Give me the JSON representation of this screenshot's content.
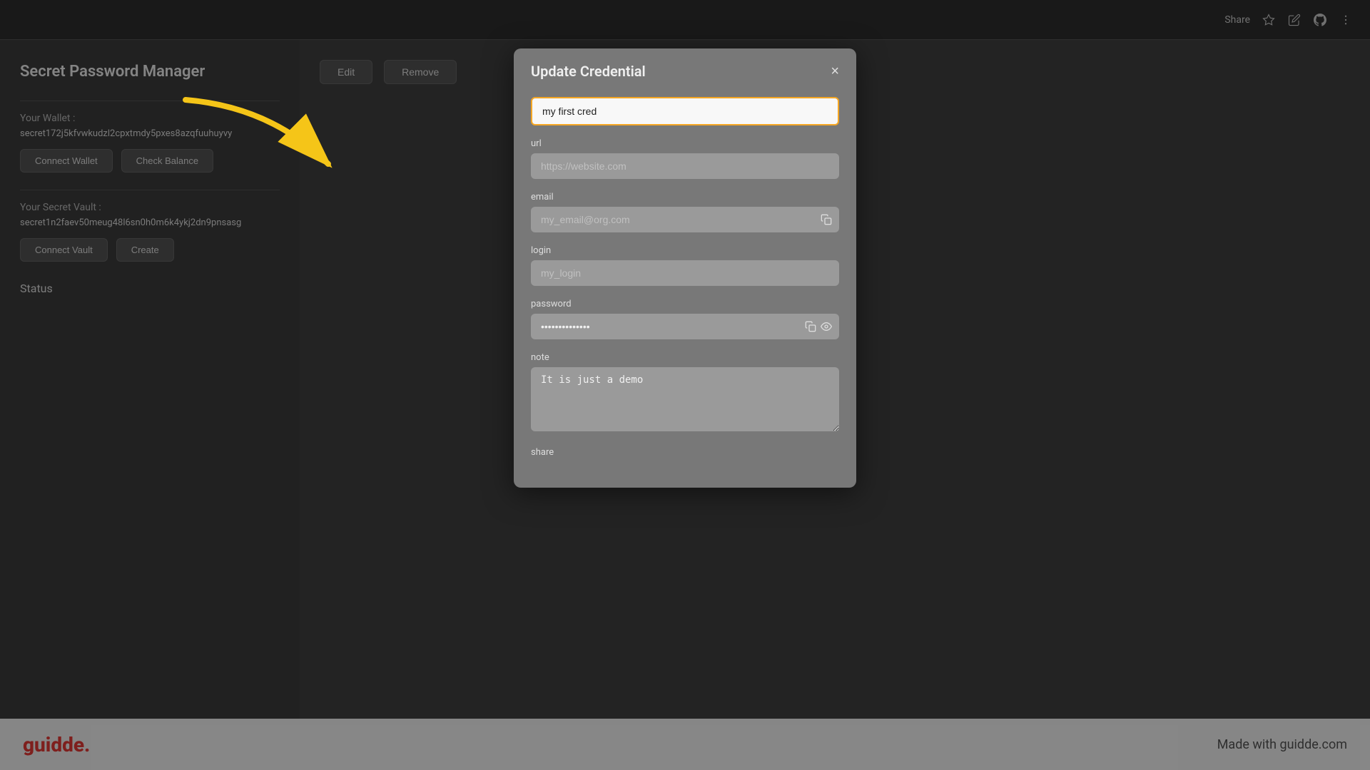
{
  "app": {
    "title": "Secret Password Manager",
    "top_bar": {
      "share_label": "Share",
      "share_icon": "share-icon",
      "star_icon": "star-icon",
      "edit_icon": "edit-icon",
      "github_icon": "github-icon",
      "more_icon": "more-icon"
    },
    "sidebar": {
      "wallet_label": "Your Wallet :",
      "wallet_value": "secret172j5kfvwkudzl2cpxtmdy5pxes8azqfuuhuyvy",
      "connect_wallet_label": "Connect Wallet",
      "check_balance_label": "Check Balance",
      "vault_label": "Your Secret Vault :",
      "vault_value": "secret1n2faev50meug48l6sn0h0m6k4ykj2dn9pnsasg",
      "connect_vault_label": "Connect Vault",
      "create_label": "Create",
      "status_label": "Status"
    },
    "cred_row": {
      "edit_label": "Edit",
      "remove_label": "Remove"
    }
  },
  "modal": {
    "title": "Update Credential",
    "close_label": "×",
    "fields": {
      "name_label": "",
      "name_value": "my first cred",
      "url_label": "url",
      "url_placeholder": "https://website.com",
      "email_label": "email",
      "email_placeholder": "my_email@org.com",
      "login_label": "login",
      "login_placeholder": "my_login",
      "password_label": "password",
      "password_value": "••••••••••",
      "note_label": "note",
      "note_value": "It is just a demo",
      "share_label": "share"
    }
  },
  "bottom_bar": {
    "logo": "guidde.",
    "made_with": "Made with guidde.com"
  }
}
